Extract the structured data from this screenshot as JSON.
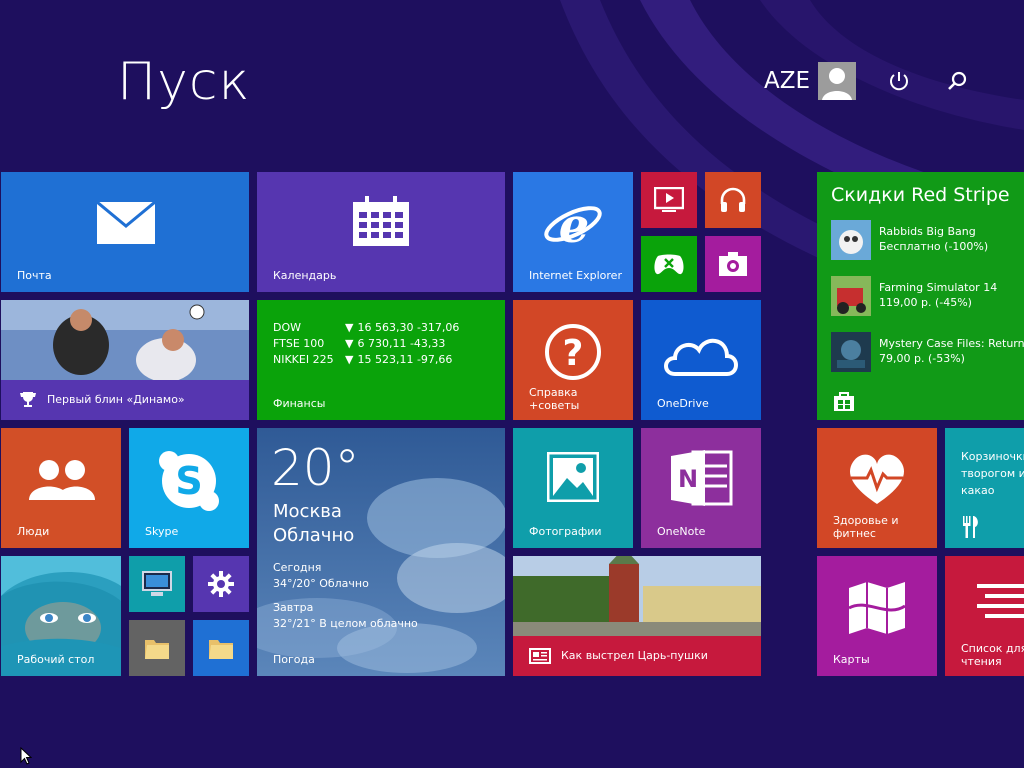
{
  "header": {
    "title": "Пуск",
    "user_name": "AZE"
  },
  "icons": {
    "power": "power-icon",
    "search": "search-icon"
  },
  "colors": {
    "background": "#1e0f5e",
    "mail": "#1f70d4",
    "calendar": "#5636b0",
    "ie": "#2a78e4",
    "finance": "#0aa30a",
    "help": "#d24726",
    "onedrive": "#0f5bd0",
    "people": "#d24f27",
    "skype": "#10a9e8",
    "photos": "#0f9eaa",
    "onenote": "#8d2f9d",
    "store": "#119a17",
    "health": "#d24726",
    "food": "#0f9eaa",
    "maps": "#a41c9e",
    "reading": "#c6193d"
  },
  "tiles": {
    "mail": "Почта",
    "calendar": "Календарь",
    "ie": "Internet Explorer",
    "sport": "Первый блин «Динамо»",
    "finance": "Финансы",
    "help_line1": "Справка",
    "help_line2": "+советы",
    "onedrive": "OneDrive",
    "people": "Люди",
    "skype": "Skype",
    "weather": "Погода",
    "photos": "Фотографии",
    "onenote": "OneNote",
    "desktop": "Рабочий стол",
    "news": "Как выстрел Царь-пушки",
    "health_line1": "Здоровье и",
    "health_line2": "фитнес",
    "food_line1": "Корзиночки с",
    "food_line2": "творогом и",
    "food_line3": "какао",
    "maps": "Карты",
    "reading_line1": "Список для",
    "reading_line2": "чтения"
  },
  "finance": {
    "rows": [
      {
        "name": "DOW",
        "value": "16 563,30 -317,06"
      },
      {
        "name": "FTSE 100",
        "value": "6 730,11 -43,33"
      },
      {
        "name": "NIKKEI 225",
        "value": "15 523,11 -97,66"
      }
    ]
  },
  "weather": {
    "temp": "20°",
    "city": "Москва",
    "condition": "Облачно",
    "today_label": "Сегодня",
    "today_value": "34°/20° Облачно",
    "tomorrow_label": "Завтра",
    "tomorrow_value": "32°/21° В целом облачно"
  },
  "store": {
    "title": "Скидки Red Stripe",
    "items": [
      {
        "name": "Rabbids Big Bang",
        "price": "Бесплатно (-100%)"
      },
      {
        "name": "Farming Simulator 14",
        "price": "119,00 р. (-45%)"
      },
      {
        "name": "Mystery Case Files: Return t",
        "price": "79,00 р. (-53%)"
      }
    ]
  }
}
